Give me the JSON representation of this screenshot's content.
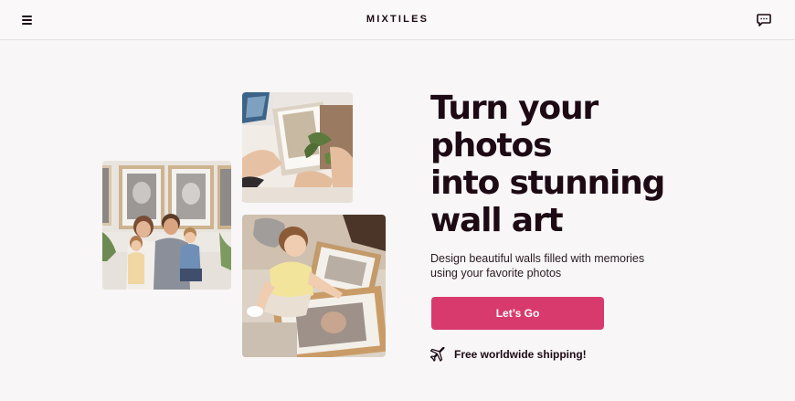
{
  "header": {
    "brand": "MIXTILES",
    "menu_icon": "hamburger-menu-icon",
    "chat_icon": "chat-bubble-icon"
  },
  "hero": {
    "headline_lines": [
      "Turn your",
      "photos",
      "into stunning",
      "wall art"
    ],
    "subtext": "Design beautiful walls filled with memories using your favorite photos",
    "cta_label": "Let’s Go",
    "shipping_icon": "airplane-icon",
    "shipping_text": "Free worldwide shipping!"
  },
  "colors": {
    "background": "#f8f6f7",
    "text": "#1d0a14",
    "accent": "#d83a6e"
  }
}
